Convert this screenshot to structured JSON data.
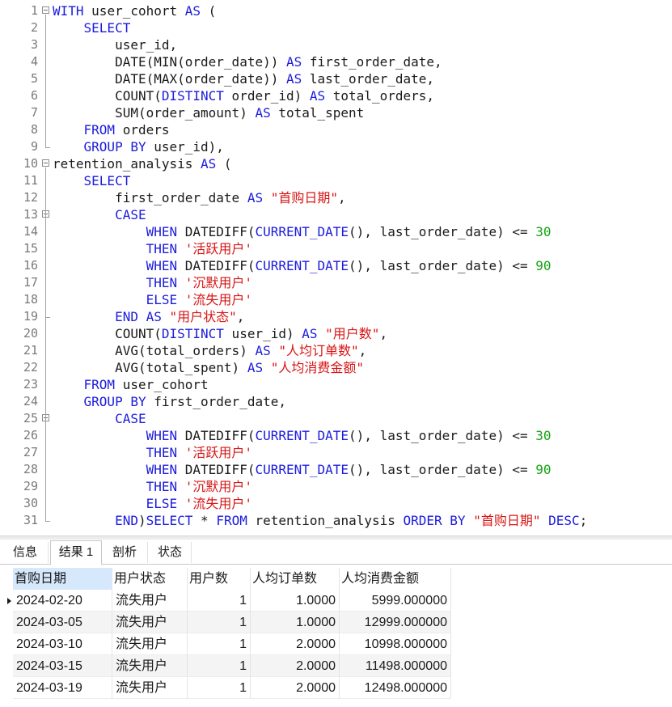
{
  "editor": {
    "lines": [
      {
        "n": "1",
        "parts": [
          [
            "kw",
            "WITH "
          ],
          [
            "",
            "user_cohort "
          ],
          [
            "kw",
            "AS"
          ],
          [
            "",
            " ("
          ]
        ]
      },
      {
        "n": "2",
        "parts": [
          [
            "",
            "    "
          ],
          [
            "kw",
            "SELECT"
          ]
        ]
      },
      {
        "n": "3",
        "parts": [
          [
            "",
            "        user_id,"
          ]
        ]
      },
      {
        "n": "4",
        "parts": [
          [
            "",
            "        DATE(MIN(order_date)) "
          ],
          [
            "kw",
            "AS"
          ],
          [
            "",
            " first_order_date,"
          ]
        ]
      },
      {
        "n": "5",
        "parts": [
          [
            "",
            "        DATE(MAX(order_date)) "
          ],
          [
            "kw",
            "AS"
          ],
          [
            "",
            " last_order_date,"
          ]
        ]
      },
      {
        "n": "6",
        "parts": [
          [
            "",
            "        COUNT("
          ],
          [
            "kw",
            "DISTINCT"
          ],
          [
            "",
            " order_id) "
          ],
          [
            "kw",
            "AS"
          ],
          [
            "",
            " total_orders,"
          ]
        ]
      },
      {
        "n": "7",
        "parts": [
          [
            "",
            "        SUM(order_amount) "
          ],
          [
            "kw",
            "AS"
          ],
          [
            "",
            " total_spent"
          ]
        ]
      },
      {
        "n": "8",
        "parts": [
          [
            "",
            "    "
          ],
          [
            "kw",
            "FROM"
          ],
          [
            "",
            " orders"
          ]
        ]
      },
      {
        "n": "9",
        "parts": [
          [
            "",
            "    "
          ],
          [
            "kw",
            "GROUP BY"
          ],
          [
            "",
            " user_id),"
          ]
        ]
      },
      {
        "n": "10",
        "parts": [
          [
            "",
            "retention_analysis "
          ],
          [
            "kw",
            "AS"
          ],
          [
            "",
            " ("
          ]
        ]
      },
      {
        "n": "11",
        "parts": [
          [
            "",
            "    "
          ],
          [
            "kw",
            "SELECT"
          ]
        ]
      },
      {
        "n": "12",
        "parts": [
          [
            "",
            "        first_order_date "
          ],
          [
            "kw",
            "AS"
          ],
          [
            "",
            " "
          ],
          [
            "str",
            "\"首购日期\""
          ],
          [
            "",
            ","
          ]
        ]
      },
      {
        "n": "13",
        "parts": [
          [
            "",
            "        "
          ],
          [
            "kw",
            "CASE"
          ]
        ]
      },
      {
        "n": "14",
        "parts": [
          [
            "",
            "            "
          ],
          [
            "kw",
            "WHEN"
          ],
          [
            "",
            " DATEDIFF("
          ],
          [
            "kw",
            "CURRENT_DATE"
          ],
          [
            "",
            "(), last_order_date) <= "
          ],
          [
            "num",
            "30"
          ]
        ]
      },
      {
        "n": "15",
        "parts": [
          [
            "",
            "            "
          ],
          [
            "kw",
            "THEN"
          ],
          [
            "",
            " "
          ],
          [
            "str",
            "'活跃用户'"
          ]
        ]
      },
      {
        "n": "16",
        "parts": [
          [
            "",
            "            "
          ],
          [
            "kw",
            "WHEN"
          ],
          [
            "",
            " DATEDIFF("
          ],
          [
            "kw",
            "CURRENT_DATE"
          ],
          [
            "",
            "(), last_order_date) <= "
          ],
          [
            "num",
            "90"
          ]
        ]
      },
      {
        "n": "17",
        "parts": [
          [
            "",
            "            "
          ],
          [
            "kw",
            "THEN"
          ],
          [
            "",
            " "
          ],
          [
            "str",
            "'沉默用户'"
          ]
        ]
      },
      {
        "n": "18",
        "parts": [
          [
            "",
            "            "
          ],
          [
            "kw",
            "ELSE"
          ],
          [
            "",
            " "
          ],
          [
            "str",
            "'流失用户'"
          ]
        ]
      },
      {
        "n": "19",
        "parts": [
          [
            "",
            "        "
          ],
          [
            "kw",
            "END AS"
          ],
          [
            "",
            " "
          ],
          [
            "str",
            "\"用户状态\""
          ],
          [
            "",
            ","
          ]
        ]
      },
      {
        "n": "20",
        "parts": [
          [
            "",
            "        COUNT("
          ],
          [
            "kw",
            "DISTINCT"
          ],
          [
            "",
            " user_id) "
          ],
          [
            "kw",
            "AS"
          ],
          [
            "",
            " "
          ],
          [
            "str",
            "\"用户数\""
          ],
          [
            "",
            ","
          ]
        ]
      },
      {
        "n": "21",
        "parts": [
          [
            "",
            "        AVG(total_orders) "
          ],
          [
            "kw",
            "AS"
          ],
          [
            "",
            " "
          ],
          [
            "str",
            "\"人均订单数\""
          ],
          [
            "",
            ","
          ]
        ]
      },
      {
        "n": "22",
        "parts": [
          [
            "",
            "        AVG(total_spent) "
          ],
          [
            "kw",
            "AS"
          ],
          [
            "",
            " "
          ],
          [
            "str",
            "\"人均消费金额\""
          ]
        ]
      },
      {
        "n": "23",
        "parts": [
          [
            "",
            "    "
          ],
          [
            "kw",
            "FROM"
          ],
          [
            "",
            " user_cohort"
          ]
        ]
      },
      {
        "n": "24",
        "parts": [
          [
            "",
            "    "
          ],
          [
            "kw",
            "GROUP BY"
          ],
          [
            "",
            " first_order_date,"
          ]
        ]
      },
      {
        "n": "25",
        "parts": [
          [
            "",
            "        "
          ],
          [
            "kw",
            "CASE"
          ]
        ]
      },
      {
        "n": "26",
        "parts": [
          [
            "",
            "            "
          ],
          [
            "kw",
            "WHEN"
          ],
          [
            "",
            " DATEDIFF("
          ],
          [
            "kw",
            "CURRENT_DATE"
          ],
          [
            "",
            "(), last_order_date) <= "
          ],
          [
            "num",
            "30"
          ]
        ]
      },
      {
        "n": "27",
        "parts": [
          [
            "",
            "            "
          ],
          [
            "kw",
            "THEN"
          ],
          [
            "",
            " "
          ],
          [
            "str",
            "'活跃用户'"
          ]
        ]
      },
      {
        "n": "28",
        "parts": [
          [
            "",
            "            "
          ],
          [
            "kw",
            "WHEN"
          ],
          [
            "",
            " DATEDIFF("
          ],
          [
            "kw",
            "CURRENT_DATE"
          ],
          [
            "",
            "(), last_order_date) <= "
          ],
          [
            "num",
            "90"
          ]
        ]
      },
      {
        "n": "29",
        "parts": [
          [
            "",
            "            "
          ],
          [
            "kw",
            "THEN"
          ],
          [
            "",
            " "
          ],
          [
            "str",
            "'沉默用户'"
          ]
        ]
      },
      {
        "n": "30",
        "parts": [
          [
            "",
            "            "
          ],
          [
            "kw",
            "ELSE"
          ],
          [
            "",
            " "
          ],
          [
            "str",
            "'流失用户'"
          ]
        ]
      },
      {
        "n": "31",
        "parts": [
          [
            "",
            "        "
          ],
          [
            "kw",
            "END"
          ],
          [
            "",
            ")"
          ],
          [
            "kw",
            "SELECT"
          ],
          [
            "",
            " * "
          ],
          [
            "kw",
            "FROM"
          ],
          [
            "",
            " retention_analysis "
          ],
          [
            "kw",
            "ORDER BY"
          ],
          [
            "",
            " "
          ],
          [
            "str",
            "\"首购日期\""
          ],
          [
            "",
            " "
          ],
          [
            "kw",
            "DESC"
          ],
          [
            "",
            ";"
          ]
        ]
      }
    ]
  },
  "tabs": [
    {
      "label": "信息",
      "active": false
    },
    {
      "label": "结果 1",
      "active": true
    },
    {
      "label": "剖析",
      "active": false
    },
    {
      "label": "状态",
      "active": false
    }
  ],
  "result": {
    "columns": [
      "首购日期",
      "用户状态",
      "用户数",
      "人均订单数",
      "人均消费金额"
    ],
    "rows": [
      [
        "2024-02-20",
        "流失用户",
        "1",
        "1.0000",
        "5999.000000"
      ],
      [
        "2024-03-05",
        "流失用户",
        "1",
        "1.0000",
        "12999.000000"
      ],
      [
        "2024-03-10",
        "流失用户",
        "1",
        "2.0000",
        "10998.000000"
      ],
      [
        "2024-03-15",
        "流失用户",
        "1",
        "2.0000",
        "11498.000000"
      ],
      [
        "2024-03-19",
        "流失用户",
        "1",
        "2.0000",
        "12498.000000"
      ]
    ]
  },
  "colors": {
    "keyword": "#1b1bdd",
    "string": "#d81515",
    "number": "#15a315"
  }
}
